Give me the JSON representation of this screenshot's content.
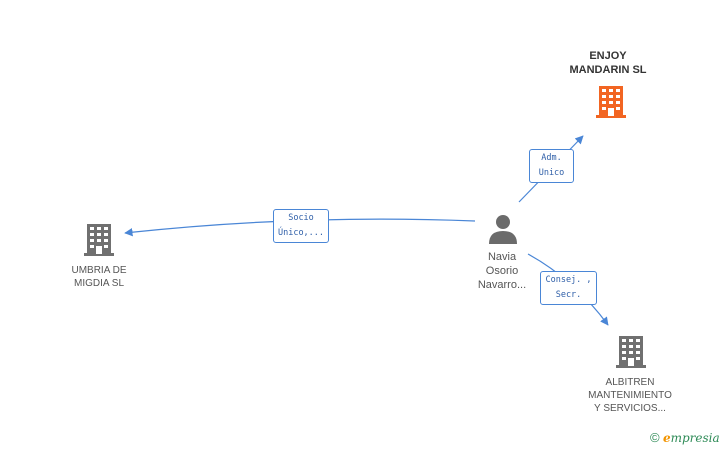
{
  "colors": {
    "edge": "#4a86d6",
    "building_default": "#707070",
    "building_focus": "#f26522",
    "person": "#6b6b6b"
  },
  "nodes": {
    "enjoy": {
      "line1": "ENJOY",
      "line2": "MANDARIN SL",
      "icon": "building-icon"
    },
    "umbria": {
      "line1": "UMBRIA DE",
      "line2": "MIGDIA SL",
      "icon": "building-icon"
    },
    "albitren": {
      "line1": "ALBITREN",
      "line2": "MANTENIMIENTO",
      "line3": "Y SERVICIOS...",
      "icon": "building-icon"
    },
    "person": {
      "line1": "Navia",
      "line2": "Osorio",
      "line3": "Navarro...",
      "icon": "person-icon"
    }
  },
  "edges": {
    "adm": {
      "line1": "Adm.",
      "line2": "Unico"
    },
    "socio": {
      "line1": "Socio",
      "line2": "Único,..."
    },
    "consej": {
      "line1": "Consej. ,",
      "line2": "Secr."
    }
  },
  "brand": {
    "copyright": "©",
    "e": "e",
    "rest": "mpresia"
  }
}
